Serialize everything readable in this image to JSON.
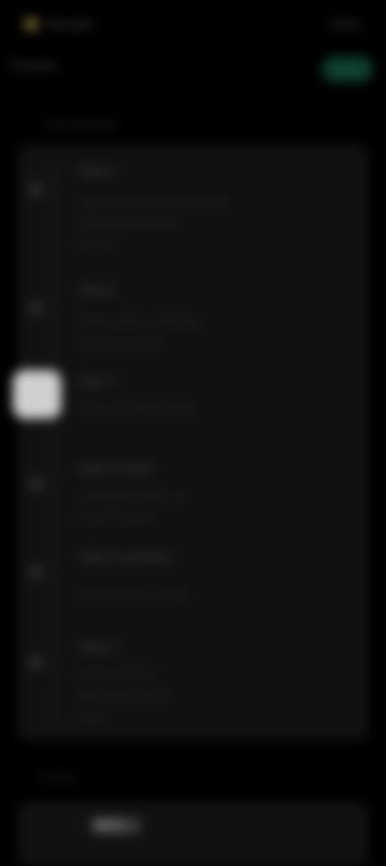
{
  "status": {
    "left_text": "Recorder",
    "right_text": "Status"
  },
  "header": {
    "back_label": "Timeline",
    "action_label": "Save"
  },
  "section": {
    "title": "Track progress"
  },
  "timeline": {
    "items": [
      {
        "title": "Step 1",
        "line1": "Capture the initial source frames",
        "line2": "Align reference points",
        "line3": "Review"
      },
      {
        "title": "Step 2",
        "line1": "Detect outlines and edges",
        "line2": "Label key regions",
        "line3": ""
      },
      {
        "title": "Step 3",
        "line1": "Generate preview output",
        "line2": "",
        "line3": ""
      },
      {
        "title": "Step 4 result",
        "line1": "Compare with prior run",
        "line2": "Flag differences",
        "line3": ""
      },
      {
        "title": "Step 5 summary",
        "line1": "Compile the final report",
        "line2": "",
        "line3": ""
      },
      {
        "title": "Step 6",
        "line1": "Export and share",
        "line2": "Archive project files",
        "line3": "Done"
      }
    ]
  },
  "footer": {
    "title": "Activity",
    "pill": "Open"
  },
  "colors": {
    "background": "#000000",
    "accent": "#0d3b2a",
    "active_marker": "#d0d0d0"
  }
}
